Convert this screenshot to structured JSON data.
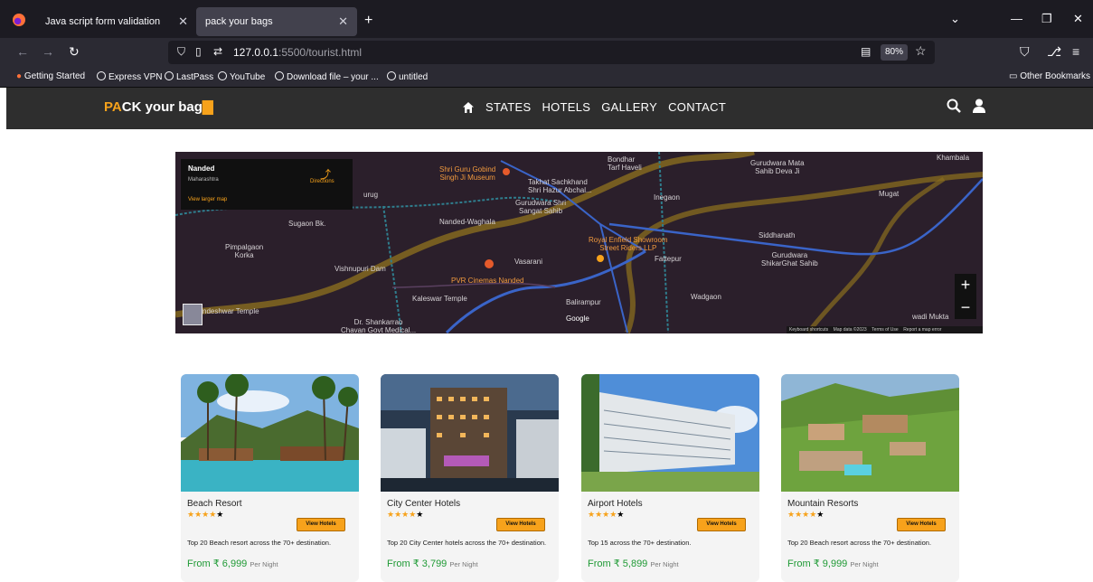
{
  "browser": {
    "tabs": [
      {
        "title": "Java script form validation"
      },
      {
        "title": "pack your bags"
      }
    ],
    "url_prefix": "127.0.0.1",
    "url_rest": ":5500/tourist.html",
    "zoom": "80%",
    "bookmarks": [
      "Getting Started",
      "Express VPN",
      "LastPass",
      "YouTube",
      "Download file – your ...",
      "untitled"
    ],
    "other_bookmarks": "Other Bookmarks"
  },
  "site": {
    "logo_p": "P",
    "logo_a": "A",
    "logo_rest": "CK your bag",
    "nav": [
      "STATES",
      "HOTELS",
      "GALLERY",
      "CONTACT"
    ]
  },
  "map": {
    "place_title": "Nanded",
    "place_state": "Maharashtra",
    "larger_map": "View larger map",
    "directions": "Directions",
    "labels": {
      "bondhar": "Bondhar\nTarf Haveli",
      "khambala": "Khambala",
      "gurudwara_mata": "Gurudwara Mata\nSahib Deva Ji",
      "shri_guru": "Shri Guru Gobind\nSingh Ji Museum",
      "takhat": "Takhat Sachkhand\nShri Hazur Abchal...",
      "gurudwara_shri": "Gurudwara Shri\nSangat Sahib",
      "inegaon": "Inegaon",
      "mugat": "Mugat",
      "sugaon": "Sugaon Bk.",
      "nanded_waghala": "Nanded-Waghala",
      "royal_enfield": "Royal Enfield Showroom\nStreet Riders LLP",
      "siddhanath": "Siddhanath",
      "pimpalgaon": "Pimpalgaon\nKorka",
      "vasarani": "Vasarani",
      "fattepur": "Fattepur",
      "gurudwara_shikar": "Gurudwara\nShikarGhat Sahib",
      "vishnupuri": "Vishnupuri Dam",
      "pvr": "PVR Cinemas Nanded",
      "kaleswar": "Kaleswar Temple",
      "balirampur": "Balirampur",
      "wadgaon": "Wadgaon",
      "ndeshwar": "ndeshwar Temple",
      "shankarrao": "Dr. Shankarrao\nChavan Govt Medical...",
      "wadi_mukta": "wadi Mukta",
      "urug": "urug",
      "google": "Google"
    },
    "footer": [
      "Keyboard shortcuts",
      "Map data ©2023",
      "Terms of Use",
      "Report a map error"
    ]
  },
  "cards": [
    {
      "name": "Beach Resort",
      "button": "View Hotels",
      "desc": "Top 20 Beach resort across the 70+ destination.",
      "price": "From ₹ 6,999",
      "per": "Per Night",
      "rating": 4
    },
    {
      "name": "City Center Hotels",
      "button": "View Hotels",
      "desc": "Top 20 City Center hotels across the 70+ destination.",
      "price": "From ₹ 3,799",
      "per": "Per Night",
      "rating": 4
    },
    {
      "name": "Airport Hotels",
      "button": "View Hotels",
      "desc": "Top 15 across the 70+ destination.",
      "price": "From ₹ 5,899",
      "per": "Per Night",
      "rating": 4
    },
    {
      "name": "Mountain Resorts",
      "button": "View Hotels",
      "desc": "Top 20 Beach resort across the 70+ destination.",
      "price": "From ₹ 9,999",
      "per": "Per Night",
      "rating": 4
    }
  ]
}
